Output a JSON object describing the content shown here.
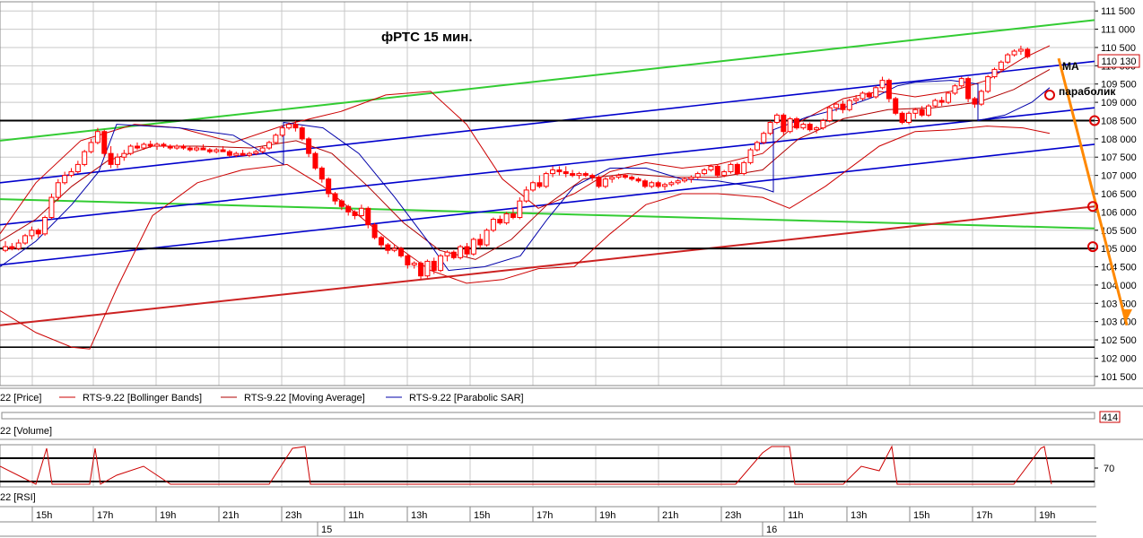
{
  "chart_data": {
    "type": "candlestick",
    "title": "фРТС   15 мин.",
    "y_ticks": [
      101500,
      102000,
      102500,
      103000,
      103500,
      104000,
      104500,
      105000,
      105500,
      106000,
      106500,
      107000,
      107500,
      108000,
      108500,
      109000,
      109500,
      110000,
      110500,
      111000,
      111500
    ],
    "y_tick_labels": [
      "101 500",
      "102 000",
      "102 500",
      "103 000",
      "103 500",
      "104 000",
      "104 500",
      "105 000",
      "105 500",
      "106 000",
      "106 500",
      "107 000",
      "107 500",
      "108 000",
      "108 500",
      "109 000",
      "109 500",
      "110 000",
      "110 500",
      "111 000",
      "111 500"
    ],
    "ylim": [
      101250,
      111750
    ],
    "last_price": 110130,
    "last_price_label": "110 130",
    "volume_box_value": "414",
    "rsi_tick_label": "70",
    "time_ticks": [
      "15h",
      "17h",
      "19h",
      "21h",
      "23h",
      "11h",
      "13h",
      "15h",
      "17h",
      "19h",
      "21h",
      "23h",
      "11h",
      "13h",
      "15h",
      "17h",
      "19h",
      "21h",
      "23h",
      "11h",
      "13h",
      "15h",
      "17h",
      "19h"
    ],
    "day_ticks": [
      "15",
      "16"
    ],
    "candles": [
      [
        104950,
        105200,
        104900,
        105050
      ],
      [
        105050,
        105150,
        104950,
        105000
      ],
      [
        105000,
        105250,
        104950,
        105150
      ],
      [
        105150,
        105400,
        105100,
        105350
      ],
      [
        105350,
        105600,
        105250,
        105500
      ],
      [
        105500,
        105550,
        105300,
        105400
      ],
      [
        105400,
        105900,
        105350,
        105850
      ],
      [
        105850,
        106500,
        105800,
        106400
      ],
      [
        106400,
        106900,
        106300,
        106800
      ],
      [
        106800,
        107100,
        106750,
        107000
      ],
      [
        107000,
        107200,
        106950,
        107100
      ],
      [
        107100,
        107400,
        107050,
        107300
      ],
      [
        107300,
        107700,
        107250,
        107650
      ],
      [
        107650,
        108000,
        107600,
        107900
      ],
      [
        107900,
        108300,
        107850,
        108200
      ],
      [
        108200,
        108250,
        107500,
        107600
      ],
      [
        107600,
        107800,
        107200,
        107300
      ],
      [
        107300,
        107600,
        107200,
        107500
      ],
      [
        107500,
        107700,
        107400,
        107600
      ],
      [
        107600,
        107850,
        107550,
        107800
      ],
      [
        107800,
        107900,
        107700,
        107750
      ],
      [
        107750,
        107900,
        107700,
        107850
      ],
      [
        107850,
        107950,
        107750,
        107800
      ],
      [
        107800,
        107900,
        107700,
        107850
      ],
      [
        107850,
        107900,
        107750,
        107800
      ],
      [
        107800,
        107850,
        107700,
        107750
      ],
      [
        107750,
        107850,
        107700,
        107800
      ],
      [
        107800,
        107850,
        107700,
        107750
      ],
      [
        107750,
        107800,
        107650,
        107700
      ],
      [
        107700,
        107800,
        107650,
        107750
      ],
      [
        107750,
        107850,
        107700,
        107700
      ],
      [
        107700,
        107750,
        107600,
        107650
      ],
      [
        107650,
        107750,
        107600,
        107700
      ],
      [
        107700,
        107800,
        107650,
        107650
      ],
      [
        107650,
        107700,
        107500,
        107550
      ],
      [
        107550,
        107650,
        107500,
        107600
      ],
      [
        107600,
        107700,
        107550,
        107550
      ],
      [
        107550,
        107650,
        107500,
        107600
      ],
      [
        107600,
        107700,
        107550,
        107650
      ],
      [
        107650,
        107800,
        107600,
        107750
      ],
      [
        107750,
        107950,
        107700,
        107900
      ],
      [
        107900,
        108150,
        107850,
        108100
      ],
      [
        108100,
        108350,
        108050,
        108300
      ],
      [
        108300,
        108450,
        108250,
        108400
      ],
      [
        108400,
        108500,
        108200,
        108300
      ],
      [
        108300,
        108350,
        107950,
        108000
      ],
      [
        108000,
        108050,
        107500,
        107600
      ],
      [
        107600,
        107650,
        107150,
        107200
      ],
      [
        107200,
        107250,
        106800,
        106900
      ],
      [
        106900,
        106950,
        106400,
        106500
      ],
      [
        106500,
        106550,
        106200,
        106300
      ],
      [
        106300,
        106350,
        106050,
        106150
      ],
      [
        106150,
        106200,
        105900,
        106000
      ],
      [
        106000,
        106050,
        105800,
        105900
      ],
      [
        105900,
        106200,
        105850,
        106100
      ],
      [
        106100,
        106150,
        105550,
        105650
      ],
      [
        105650,
        105700,
        105250,
        105300
      ],
      [
        105300,
        105350,
        105000,
        105100
      ],
      [
        105100,
        105150,
        104850,
        104950
      ],
      [
        104950,
        105100,
        104900,
        105000
      ],
      [
        105000,
        105050,
        104750,
        104800
      ],
      [
        104800,
        104850,
        104450,
        104550
      ],
      [
        104550,
        104650,
        104450,
        104600
      ],
      [
        104600,
        104650,
        104150,
        104250
      ],
      [
        104250,
        104700,
        104200,
        104650
      ],
      [
        104650,
        104750,
        104300,
        104400
      ],
      [
        104400,
        104850,
        104350,
        104800
      ],
      [
        104800,
        104950,
        104650,
        104900
      ],
      [
        104900,
        104950,
        104700,
        104750
      ],
      [
        104750,
        105100,
        104700,
        105050
      ],
      [
        105050,
        105150,
        104750,
        104850
      ],
      [
        104850,
        105300,
        104800,
        105250
      ],
      [
        105250,
        105400,
        105000,
        105100
      ],
      [
        105100,
        105550,
        105050,
        105500
      ],
      [
        105500,
        105850,
        105450,
        105800
      ],
      [
        105800,
        105900,
        105650,
        105700
      ],
      [
        105700,
        106000,
        105650,
        105950
      ],
      [
        105950,
        106100,
        105800,
        105850
      ],
      [
        105850,
        106400,
        105800,
        106300
      ],
      [
        106300,
        106700,
        106250,
        106600
      ],
      [
        106600,
        106850,
        106550,
        106800
      ],
      [
        106800,
        107000,
        106650,
        106700
      ],
      [
        106700,
        107100,
        106650,
        107050
      ],
      [
        107050,
        107250,
        106950,
        107150
      ],
      [
        107150,
        107250,
        107000,
        107100
      ],
      [
        107100,
        107250,
        106950,
        107050
      ],
      [
        107050,
        107150,
        106950,
        107000
      ],
      [
        107000,
        107100,
        106900,
        107050
      ],
      [
        107050,
        107100,
        106950,
        107000
      ],
      [
        107000,
        107050,
        106850,
        106950
      ],
      [
        106950,
        107000,
        106650,
        106700
      ],
      [
        106700,
        106950,
        106650,
        106900
      ],
      [
        106900,
        107000,
        106800,
        106950
      ],
      [
        106950,
        107050,
        106900,
        107000
      ],
      [
        107000,
        107050,
        106900,
        106950
      ],
      [
        106950,
        107000,
        106850,
        106900
      ],
      [
        106900,
        106950,
        106800,
        106850
      ],
      [
        106850,
        106900,
        106650,
        106700
      ],
      [
        106700,
        106850,
        106650,
        106800
      ],
      [
        106800,
        106850,
        106650,
        106700
      ],
      [
        106700,
        106800,
        106600,
        106750
      ],
      [
        106750,
        106850,
        106700,
        106800
      ],
      [
        106800,
        106900,
        106750,
        106850
      ],
      [
        106850,
        106950,
        106800,
        106900
      ],
      [
        106900,
        107000,
        106800,
        106950
      ],
      [
        106950,
        107100,
        106900,
        107050
      ],
      [
        107050,
        107200,
        107000,
        107150
      ],
      [
        107150,
        107300,
        107100,
        107250
      ],
      [
        107250,
        107300,
        106950,
        107000
      ],
      [
        107000,
        107150,
        106950,
        107100
      ],
      [
        107100,
        107350,
        107050,
        107300
      ],
      [
        107300,
        107350,
        107000,
        107050
      ],
      [
        107050,
        107400,
        107000,
        107350
      ],
      [
        107350,
        107750,
        107300,
        107700
      ],
      [
        107700,
        107950,
        107650,
        107900
      ],
      [
        107900,
        108200,
        107850,
        108150
      ],
      [
        108150,
        108500,
        108100,
        108450
      ],
      [
        108450,
        108700,
        108400,
        108650
      ],
      [
        108650,
        108700,
        108100,
        108200
      ],
      [
        108200,
        108600,
        108150,
        108550
      ],
      [
        108550,
        108600,
        108250,
        108300
      ],
      [
        108300,
        108450,
        108250,
        108400
      ],
      [
        108400,
        108450,
        108200,
        108250
      ],
      [
        108250,
        108350,
        108150,
        108300
      ],
      [
        108300,
        108550,
        108250,
        108500
      ],
      [
        108500,
        108900,
        108450,
        108850
      ],
      [
        108850,
        109000,
        108750,
        108950
      ],
      [
        108950,
        109050,
        108700,
        108800
      ],
      [
        108800,
        109100,
        108750,
        109050
      ],
      [
        109050,
        109200,
        108950,
        109100
      ],
      [
        109100,
        109300,
        109050,
        109250
      ],
      [
        109250,
        109300,
        109100,
        109150
      ],
      [
        109150,
        109450,
        109100,
        109400
      ],
      [
        109400,
        109700,
        109350,
        109600
      ],
      [
        109600,
        109650,
        109000,
        109100
      ],
      [
        109100,
        109150,
        108650,
        108700
      ],
      [
        108700,
        108750,
        108400,
        108450
      ],
      [
        108450,
        108750,
        108400,
        108700
      ],
      [
        108700,
        108850,
        108550,
        108800
      ],
      [
        108800,
        108900,
        108600,
        108650
      ],
      [
        108650,
        108950,
        108600,
        108900
      ],
      [
        108900,
        109100,
        108850,
        109050
      ],
      [
        109050,
        109150,
        108900,
        109000
      ],
      [
        109000,
        109300,
        108950,
        109250
      ],
      [
        109250,
        109500,
        109200,
        109450
      ],
      [
        109450,
        109700,
        109400,
        109650
      ],
      [
        109650,
        109700,
        109000,
        109100
      ],
      [
        109100,
        109150,
        108850,
        108950
      ],
      [
        108950,
        109350,
        108900,
        109300
      ],
      [
        109300,
        109750,
        109250,
        109700
      ],
      [
        109700,
        109950,
        109650,
        109900
      ],
      [
        109900,
        110150,
        109850,
        110100
      ],
      [
        110100,
        110350,
        110050,
        110300
      ],
      [
        110300,
        110450,
        110250,
        110400
      ],
      [
        110400,
        110550,
        110300,
        110450
      ],
      [
        110450,
        110500,
        110200,
        110250
      ]
    ],
    "bollinger_upper": [
      [
        0,
        105400
      ],
      [
        40,
        106800
      ],
      [
        90,
        107950
      ],
      [
        150,
        108400
      ],
      [
        200,
        108300
      ],
      [
        260,
        107900
      ],
      [
        320,
        108400
      ],
      [
        380,
        108750
      ],
      [
        430,
        109200
      ],
      [
        480,
        109300
      ],
      [
        520,
        108400
      ],
      [
        560,
        106900
      ],
      [
        600,
        106100
      ],
      [
        640,
        106500
      ],
      [
        680,
        107100
      ],
      [
        720,
        107350
      ],
      [
        760,
        107200
      ],
      [
        800,
        107300
      ],
      [
        850,
        107600
      ],
      [
        890,
        108450
      ],
      [
        940,
        109100
      ],
      [
        980,
        109300
      ],
      [
        1020,
        109150
      ],
      [
        1060,
        109300
      ],
      [
        1100,
        109600
      ],
      [
        1140,
        110200
      ],
      [
        1170,
        110550
      ]
    ],
    "bollinger_lower": [
      [
        0,
        103300
      ],
      [
        40,
        102700
      ],
      [
        80,
        102300
      ],
      [
        100,
        102250
      ],
      [
        130,
        103900
      ],
      [
        170,
        105900
      ],
      [
        220,
        106800
      ],
      [
        270,
        107150
      ],
      [
        320,
        107300
      ],
      [
        360,
        106700
      ],
      [
        400,
        105900
      ],
      [
        440,
        105100
      ],
      [
        480,
        104400
      ],
      [
        520,
        104050
      ],
      [
        560,
        104150
      ],
      [
        600,
        104450
      ],
      [
        640,
        104500
      ],
      [
        680,
        105400
      ],
      [
        720,
        106200
      ],
      [
        760,
        106500
      ],
      [
        800,
        106500
      ],
      [
        850,
        106400
      ],
      [
        880,
        106100
      ],
      [
        920,
        106700
      ],
      [
        980,
        107800
      ],
      [
        1020,
        108200
      ],
      [
        1060,
        108250
      ],
      [
        1100,
        108350
      ],
      [
        1140,
        108300
      ],
      [
        1170,
        108150
      ]
    ],
    "moving_average": [
      [
        0,
        105200
      ],
      [
        40,
        105800
      ],
      [
        80,
        106700
      ],
      [
        120,
        107400
      ],
      [
        170,
        107800
      ],
      [
        220,
        107800
      ],
      [
        280,
        107750
      ],
      [
        330,
        107950
      ],
      [
        370,
        107600
      ],
      [
        410,
        106700
      ],
      [
        450,
        105700
      ],
      [
        490,
        104950
      ],
      [
        530,
        104700
      ],
      [
        570,
        105250
      ],
      [
        610,
        106200
      ],
      [
        650,
        106900
      ],
      [
        700,
        107050
      ],
      [
        750,
        106950
      ],
      [
        800,
        106950
      ],
      [
        850,
        107150
      ],
      [
        890,
        108000
      ],
      [
        940,
        108550
      ],
      [
        990,
        108800
      ],
      [
        1040,
        108850
      ],
      [
        1090,
        109000
      ],
      [
        1130,
        109350
      ],
      [
        1170,
        109900
      ]
    ],
    "parabolic_sar": [
      [
        0,
        104500
      ],
      [
        40,
        105200
      ],
      [
        80,
        106200
      ],
      [
        110,
        107100
      ],
      [
        130,
        108400
      ],
      [
        200,
        108300
      ],
      [
        260,
        108100
      ],
      [
        316,
        107300
      ],
      [
        316,
        108450
      ],
      [
        360,
        108300
      ],
      [
        400,
        107600
      ],
      [
        440,
        106400
      ],
      [
        480,
        105100
      ],
      [
        500,
        104400
      ],
      [
        540,
        104500
      ],
      [
        580,
        104800
      ],
      [
        610,
        105800
      ],
      [
        640,
        106700
      ],
      [
        680,
        107200
      ],
      [
        720,
        107200
      ],
      [
        760,
        106900
      ],
      [
        800,
        106850
      ],
      [
        850,
        106650
      ],
      [
        862,
        106550
      ],
      [
        862,
        108250
      ],
      [
        900,
        108600
      ],
      [
        940,
        108850
      ],
      [
        980,
        109200
      ],
      [
        1000,
        109450
      ],
      [
        1020,
        109550
      ],
      [
        1060,
        109600
      ],
      [
        1090,
        109500
      ],
      [
        1090,
        108500
      ],
      [
        1120,
        108650
      ],
      [
        1150,
        109000
      ],
      [
        1170,
        109400
      ]
    ],
    "legend": [
      "22 [Price]",
      "RTS-9.22 [Bollinger Bands]",
      "RTS-9.22 [Moving Average]",
      "RTS-9.22 [Parabolic SAR]"
    ],
    "panels": [
      "22 [Volume]",
      "22 [RSI]"
    ],
    "annotations": [
      "МА",
      "параболик"
    ],
    "colors": {
      "candle": "#ff0000",
      "bollinger": "#cc0000",
      "ma": "#b00000",
      "sar": "#0000aa",
      "channel": "#0000cc",
      "green": "#33cc33",
      "red_trend": "#cc2222",
      "orange": "#ff8800",
      "black": "#000000",
      "rsi": "#cc0000"
    }
  }
}
